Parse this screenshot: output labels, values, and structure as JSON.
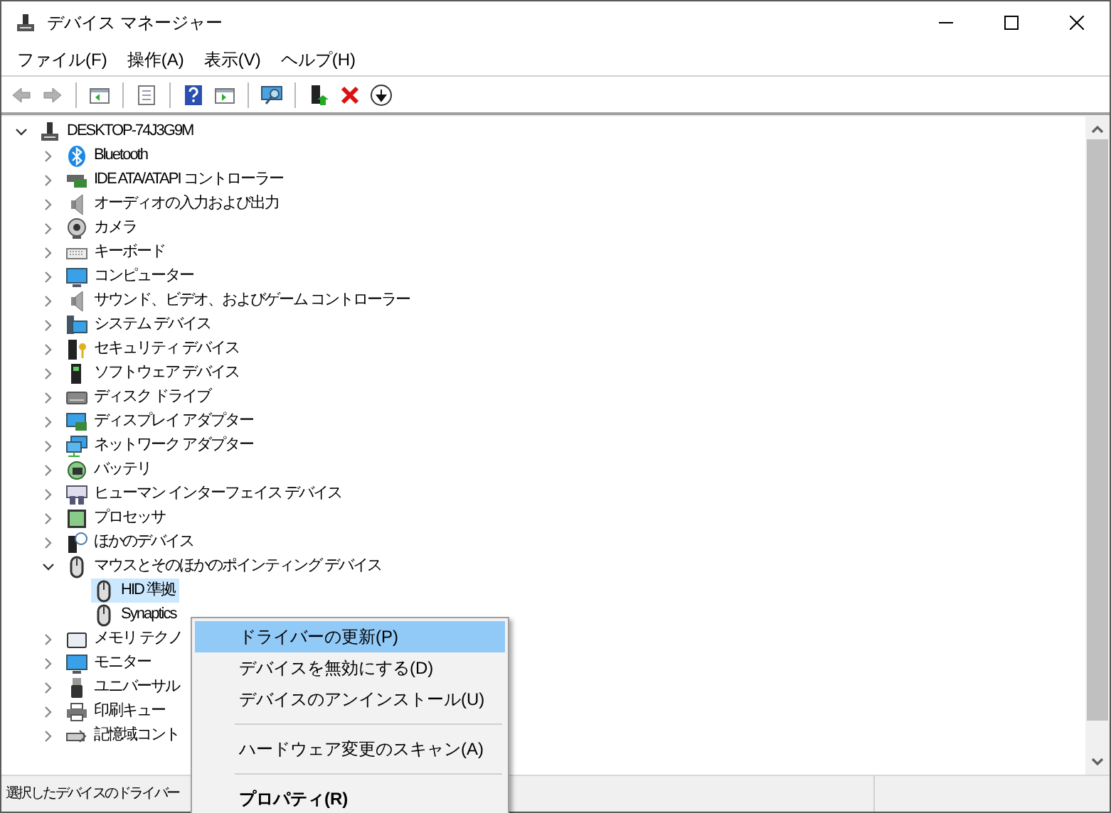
{
  "window": {
    "title": "デバイス マネージャー"
  },
  "menu_bar": [
    "ファイル(F)",
    "操作(A)",
    "表示(V)",
    "ヘルプ(H)"
  ],
  "toolbar": [
    {
      "kind": "back",
      "disabled": true
    },
    {
      "kind": "forward",
      "disabled": true
    },
    {
      "kind": "sep"
    },
    {
      "kind": "pane",
      "disabled": false
    },
    {
      "kind": "sep"
    },
    {
      "kind": "sheet",
      "disabled": false
    },
    {
      "kind": "sep"
    },
    {
      "kind": "help",
      "disabled": false
    },
    {
      "kind": "panel",
      "disabled": false
    },
    {
      "kind": "sep"
    },
    {
      "kind": "scan",
      "disabled": false
    },
    {
      "kind": "sep"
    },
    {
      "kind": "update",
      "disabled": false
    },
    {
      "kind": "remove",
      "disabled": false
    },
    {
      "kind": "download",
      "disabled": false
    }
  ],
  "tree": [
    {
      "label": "DESKTOP-74J3G9M",
      "kind": "computer",
      "expanded": true,
      "selected": false,
      "children": [
        {
          "label": "Bluetooth",
          "kind": "bluetooth",
          "expanded": false,
          "selected": false
        },
        {
          "label": "IDE ATA/ATAPI コントローラー",
          "kind": "card",
          "expanded": false,
          "selected": false
        },
        {
          "label": "オーディオの入力および出力",
          "kind": "speaker",
          "expanded": false,
          "selected": false
        },
        {
          "label": "カメラ",
          "kind": "camera",
          "expanded": false,
          "selected": false
        },
        {
          "label": "キーボード",
          "kind": "keyboard",
          "expanded": false,
          "selected": false
        },
        {
          "label": "コンピューター",
          "kind": "monitor",
          "expanded": false,
          "selected": false
        },
        {
          "label": "サウンド、ビデオ、およびゲーム コントローラー",
          "kind": "speaker",
          "expanded": false,
          "selected": false
        },
        {
          "label": "システム デバイス",
          "kind": "system",
          "expanded": false,
          "selected": false
        },
        {
          "label": "セキュリティ デバイス",
          "kind": "security",
          "expanded": false,
          "selected": false
        },
        {
          "label": "ソフトウェア デバイス",
          "kind": "software",
          "expanded": false,
          "selected": false
        },
        {
          "label": "ディスク ドライブ",
          "kind": "disk",
          "expanded": false,
          "selected": false
        },
        {
          "label": "ディスプレイ アダプター",
          "kind": "display",
          "expanded": false,
          "selected": false
        },
        {
          "label": "ネットワーク アダプター",
          "kind": "network",
          "expanded": false,
          "selected": false
        },
        {
          "label": "バッテリ",
          "kind": "battery",
          "expanded": false,
          "selected": false
        },
        {
          "label": "ヒューマン インターフェイス デバイス",
          "kind": "hid",
          "expanded": false,
          "selected": false
        },
        {
          "label": "プロセッサ",
          "kind": "chip",
          "expanded": false,
          "selected": false
        },
        {
          "label": "ほかのデバイス",
          "kind": "unknown",
          "expanded": false,
          "selected": false
        },
        {
          "label": "マウスとそのほかのポインティング デバイス",
          "kind": "mouse",
          "expanded": true,
          "selected": false,
          "children": [
            {
              "label": "HID 準拠",
              "kind": "mouse",
              "selected": true
            },
            {
              "label": "Synaptics",
              "kind": "mouse",
              "selected": false
            }
          ]
        },
        {
          "label": "メモリ テクノ",
          "kind": "memory",
          "expanded": false,
          "selected": false
        },
        {
          "label": "モニター",
          "kind": "monitor",
          "expanded": false,
          "selected": false
        },
        {
          "label": "ユニバーサル",
          "kind": "usb",
          "expanded": false,
          "selected": false
        },
        {
          "label": "印刷キュー",
          "kind": "printer",
          "expanded": false,
          "selected": false
        },
        {
          "label": "記憶域コント",
          "kind": "storage",
          "expanded": false,
          "selected": false
        }
      ]
    }
  ],
  "context_menu": [
    {
      "kind": "item",
      "label": "ドライバーの更新(P)",
      "selected": true,
      "default": false
    },
    {
      "kind": "item",
      "label": "デバイスを無効にする(D)",
      "selected": false,
      "default": false
    },
    {
      "kind": "item",
      "label": "デバイスのアンインストール(U)",
      "selected": false,
      "default": false
    },
    {
      "kind": "separator"
    },
    {
      "kind": "item",
      "label": "ハードウェア変更のスキャン(A)",
      "selected": false,
      "default": false
    },
    {
      "kind": "separator"
    },
    {
      "kind": "item",
      "label": "プロパティ(R)",
      "selected": false,
      "default": true
    }
  ],
  "status_bar": [
    "選択したデバイスのドライバー"
  ]
}
